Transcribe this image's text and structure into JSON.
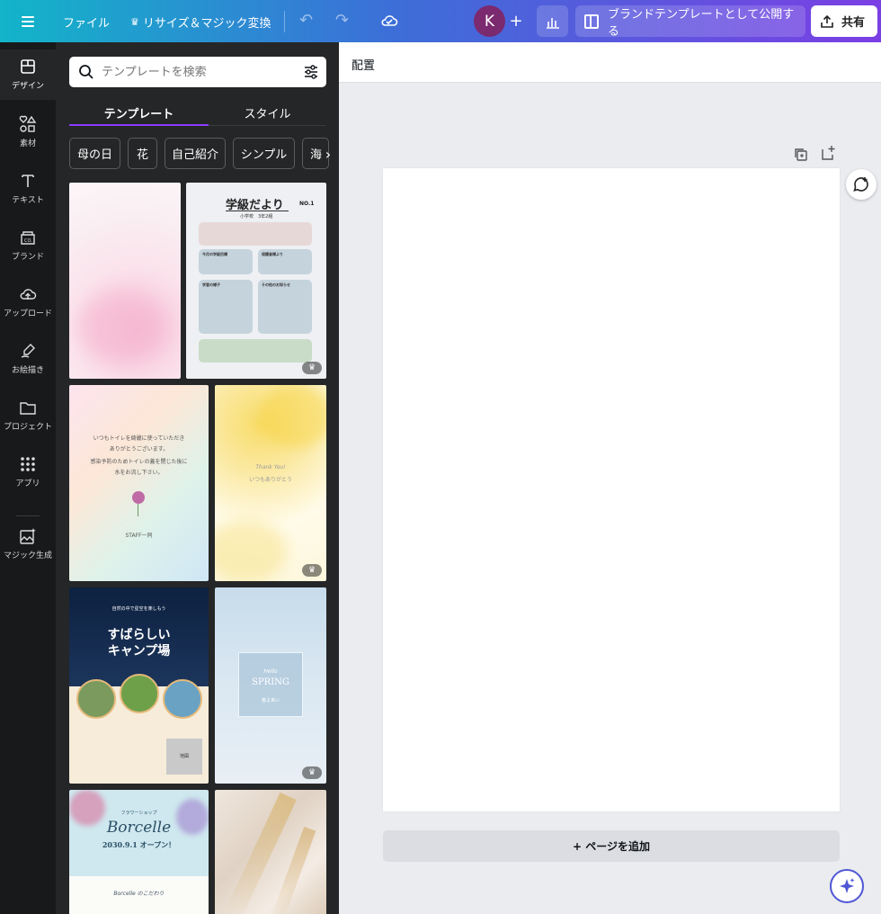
{
  "topbar": {
    "file_label": "ファイル",
    "resize_label": "リサイズ＆マジック変換",
    "avatar_initial": "K",
    "publish_label": "ブランドテンプレートとして公開する",
    "share_label": "共有"
  },
  "rail": {
    "items": [
      {
        "label": "デザイン",
        "icon": "layout-icon"
      },
      {
        "label": "素材",
        "icon": "shapes-icon"
      },
      {
        "label": "テキスト",
        "icon": "text-icon"
      },
      {
        "label": "ブランド",
        "icon": "brand-icon"
      },
      {
        "label": "アップロード",
        "icon": "upload-icon"
      },
      {
        "label": "お絵描き",
        "icon": "draw-icon"
      },
      {
        "label": "プロジェクト",
        "icon": "folder-icon"
      },
      {
        "label": "アプリ",
        "icon": "apps-icon"
      },
      {
        "label": "マジック生成",
        "icon": "magic-media-icon"
      }
    ]
  },
  "panel": {
    "search_placeholder": "テンプレートを検索",
    "tabs": [
      "テンプレート",
      "スタイル"
    ],
    "chips": [
      "母の日",
      "花",
      "自己紹介",
      "シンプル",
      "海"
    ],
    "templates": {
      "t2": {
        "title": "学級だより",
        "badge": "NO.1",
        "subtitle": "小学校　3年2組",
        "b1_title": "今月の学級目標",
        "b2_title": "保護者様より",
        "b3_title": "学習の様子",
        "b4_title": "その他のお知らせ"
      },
      "t3": {
        "line1": "いつもトイレを綺麗に使っていただき",
        "line2": "ありがとうございます。",
        "line3": "感染予防のためトイレの蓋を閉じた後に",
        "line4": "水をお流し下さい。",
        "footer": "STAFF一同"
      },
      "t4": {
        "line1": "Thank You!",
        "line2": "いつもありがとう"
      },
      "t5": {
        "tag": "自然の中で星空を楽しもう",
        "title1": "すばらしい",
        "title2": "キャンプ場",
        "map_label": "地図"
      },
      "t6": {
        "line1": "Hello",
        "line2": "SPRING",
        "line3": "春よ来い"
      },
      "t7": {
        "tag": "フラワーショップ",
        "title": "Borcelle",
        "date": "2030.9.1 オープン！",
        "footer": "Borcelle のこだわり"
      }
    }
  },
  "main": {
    "context_label": "配置",
    "add_page_label": "+ ページを追加"
  }
}
